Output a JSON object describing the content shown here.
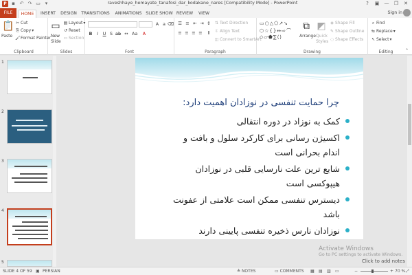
{
  "window": {
    "title": "raveshhaye_hemayate_tanafosi_dar_kodakane_nares [Compatibility Mode] - PowerPoint",
    "signin": "Sign in",
    "minimize": "—",
    "restore": "❐",
    "close": "✕"
  },
  "tabs": [
    "FILE",
    "HOME",
    "INSERT",
    "DESIGN",
    "TRANSITIONS",
    "ANIMATIONS",
    "SLIDE SHOW",
    "REVIEW",
    "VIEW"
  ],
  "active_tab": "HOME",
  "accent": "#c43e1c",
  "ribbon": {
    "clipboard": {
      "label": "Clipboard",
      "paste": "Paste",
      "cut": "Cut",
      "copy": "Copy",
      "format_painter": "Format Painter"
    },
    "slides": {
      "label": "Slides",
      "new_slide": "New",
      "new_slide2": "Slide",
      "layout": "Layout",
      "reset": "Reset",
      "section": "Section"
    },
    "font": {
      "label": "Font"
    },
    "paragraph": {
      "label": "Paragraph",
      "text_direction": "Text Direction",
      "align_text": "Align Text",
      "convert": "Convert to SmartArt"
    },
    "drawing": {
      "label": "Drawing",
      "arrange": "Arrange",
      "quick_styles": "Quick",
      "quick_styles2": "Styles",
      "shape_fill": "Shape Fill",
      "shape_outline": "Shape Outline",
      "shape_effects": "Shape Effects"
    },
    "editing": {
      "label": "Editing",
      "find": "Find",
      "replace": "Replace",
      "select": "Select"
    }
  },
  "thumbnails": [
    {
      "num": "1"
    },
    {
      "num": "2"
    },
    {
      "num": "3"
    },
    {
      "num": "4"
    },
    {
      "num": "5"
    }
  ],
  "slide": {
    "title": "چرا حمایت تنفسی در نوزادان اهمیت دارد:",
    "bullets": [
      "کمک به نوزاد در دوره انتقالی",
      "اکسیژن رسانی برای کارکرد سلول و بافت و اندام بحرانی است",
      "شایع ترین علت نارسایی قلبی در نوزادان هیپوکسی است",
      "دیسترس تنفسی ممکن است علامتی از عفونت باشد",
      "نوزادان نارس ذخیره تنفسی پایینی دارند"
    ]
  },
  "notes_hint": "Click to add notes",
  "activate": {
    "line1": "Activate Windows",
    "line2": "Go to PC settings to activate Windows."
  },
  "status": {
    "slide_of": "SLIDE 4 OF 59",
    "language": "PERSIAN",
    "notes": "NOTES",
    "comments": "COMMENTS",
    "zoom": "70 %"
  }
}
